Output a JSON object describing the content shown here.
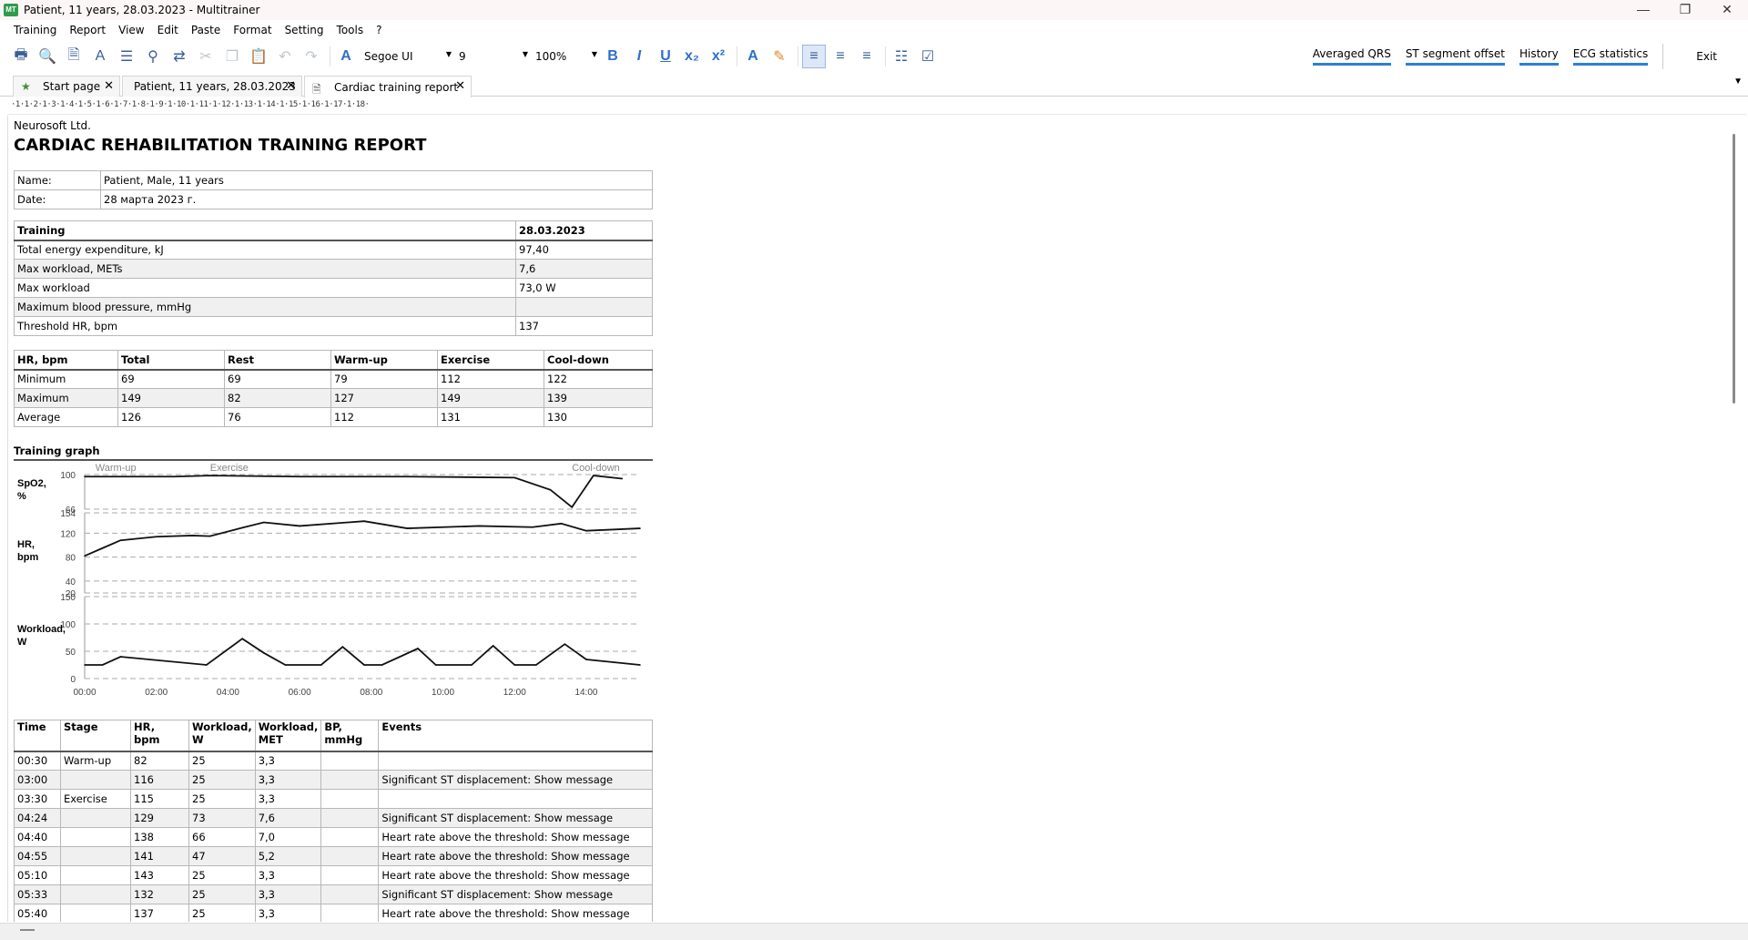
{
  "window": {
    "title": "Patient, 11 years, 28.03.2023 - Multitrainer",
    "app_icon_text": "MT",
    "controls": [
      "—",
      "❐",
      "✕"
    ]
  },
  "menu": [
    "Training",
    "Report",
    "View",
    "Edit",
    "Paste",
    "Format",
    "Setting",
    "Tools",
    "?"
  ],
  "toolbar": {
    "font_name": "Segoe UI",
    "font_size": "9",
    "zoom": "100%"
  },
  "right_links": [
    "Averaged QRS",
    "ST segment offset",
    "History",
    "ECG statistics"
  ],
  "exit_label": "Exit",
  "tabs": [
    {
      "label": "Start page",
      "active": false
    },
    {
      "label": "Patient, 11 years, 28.03.2023",
      "active": false
    },
    {
      "label": "Cardiac training report",
      "active": true
    }
  ],
  "ruler_text": "·1·1·2·1·3·1·4·1·5·1·6·1·7·1·8·1·9·1·10·1·11·1·12·1·13·1·14·1·15·1·16·1·17·1·18·",
  "report": {
    "company": "Neurosoft Ltd.",
    "title": "CARDIAC REHABILITATION TRAINING REPORT",
    "patient": [
      {
        "label": "Name:",
        "value": "Patient, Male, 11 years"
      },
      {
        "label": "Date:",
        "value": "28 марта 2023 г."
      }
    ],
    "training_header": [
      "Training",
      "28.03.2023"
    ],
    "training_rows": [
      [
        "Total energy expenditure, kJ",
        "97,40"
      ],
      [
        "Max workload, METs",
        "7,6"
      ],
      [
        "Max workload",
        "73,0 W"
      ],
      [
        "Maximum blood pressure, mmHg",
        ""
      ],
      [
        "Threshold HR, bpm",
        "137"
      ]
    ],
    "hr_header": [
      "HR, bpm",
      "Total",
      "Rest",
      "Warm-up",
      "Exercise",
      "Cool-down"
    ],
    "hr_rows": [
      [
        "Minimum",
        "69",
        "69",
        "79",
        "112",
        "122"
      ],
      [
        "Maximum",
        "149",
        "82",
        "127",
        "149",
        "139"
      ],
      [
        "Average",
        "126",
        "76",
        "112",
        "131",
        "130"
      ]
    ],
    "graph_label": "Training graph",
    "events_header": [
      "Time",
      "Stage",
      "HR,\nbpm",
      "Workload,\nW",
      "Workload,\nMET",
      "BP,\nmmHg",
      "Events"
    ],
    "events_rows": [
      [
        "00:30",
        "Warm-up",
        "82",
        "25",
        "3,3",
        "",
        ""
      ],
      [
        "03:00",
        "",
        "116",
        "25",
        "3,3",
        "",
        "Significant ST displacement: Show message"
      ],
      [
        "03:30",
        "Exercise",
        "115",
        "25",
        "3,3",
        "",
        ""
      ],
      [
        "04:24",
        "",
        "129",
        "73",
        "7,6",
        "",
        "Significant ST displacement: Show message"
      ],
      [
        "04:40",
        "",
        "138",
        "66",
        "7,0",
        "",
        "Heart rate above the threshold: Show message"
      ],
      [
        "04:55",
        "",
        "141",
        "47",
        "5,2",
        "",
        "Heart rate above the threshold: Show message"
      ],
      [
        "05:10",
        "",
        "143",
        "25",
        "3,3",
        "",
        "Heart rate above the threshold: Show message"
      ],
      [
        "05:33",
        "",
        "132",
        "25",
        "3,3",
        "",
        "Significant ST displacement: Show message"
      ],
      [
        "05:40",
        "",
        "137",
        "25",
        "3,3",
        "",
        "Heart rate above the threshold: Show message"
      ]
    ]
  },
  "chart_data": {
    "type": "line",
    "stages": [
      "Warm-up",
      "Exercise",
      "Cool-down"
    ],
    "x_ticks": [
      "00:00",
      "02:00",
      "04:00",
      "06:00",
      "08:00",
      "10:00",
      "12:00",
      "14:00"
    ],
    "x_range_min": [
      0,
      15.5
    ],
    "panels": [
      {
        "label": "SpO2,\n%",
        "ticks": [
          100,
          66
        ],
        "ylim": [
          66,
          100
        ],
        "series": [
          {
            "x": [
              0,
              2.5,
              3.5,
              6,
              9,
              12,
              13,
              13.6,
              14.2,
              15
            ],
            "y": [
              98,
              98,
              99,
              98,
              98,
              97,
              85,
              68,
              99,
              96
            ]
          }
        ]
      },
      {
        "label": "HR,\nbpm",
        "ticks": [
          154,
          120,
          80,
          40,
          20
        ],
        "ylim": [
          20,
          154
        ],
        "series": [
          {
            "x": [
              0,
              0.5,
              1,
              2,
              3,
              3.5,
              4.4,
              5,
              6,
              7.8,
              9,
              11,
              12.5,
              13.3,
              14,
              15.5
            ],
            "y": [
              82,
              95,
              108,
              114,
              116,
              115,
              129,
              138,
              132,
              140,
              128,
              132,
              130,
              136,
              124,
              128
            ]
          }
        ]
      },
      {
        "label": "Workload,\nW",
        "ticks": [
          150,
          100,
          50,
          0
        ],
        "ylim": [
          0,
          150
        ],
        "series": [
          {
            "x": [
              0,
              0.5,
              1,
              3.4,
              4.4,
              5,
              5.6,
              6.6,
              7.2,
              7.8,
              8.3,
              9.3,
              9.8,
              10.8,
              11.4,
              12,
              12.6,
              13.4,
              14,
              15.5
            ],
            "y": [
              25,
              25,
              40,
              25,
              73,
              47,
              25,
              25,
              58,
              25,
              25,
              55,
              25,
              25,
              60,
              25,
              25,
              63,
              35,
              25
            ]
          }
        ]
      }
    ]
  },
  "colors": {
    "accent": "#2f7fd1",
    "tab_border": "#d6d6d6",
    "grid_dash": "#aaaaaa"
  }
}
